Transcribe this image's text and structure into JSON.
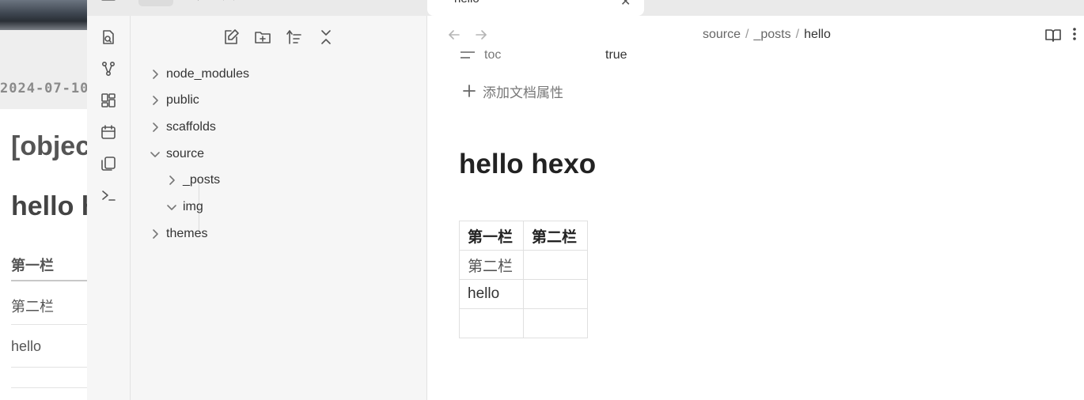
{
  "background_page": {
    "date": "2024-07-10",
    "object_heading": "[objec",
    "title": "hello h",
    "table_header": "第一栏",
    "rows": [
      "第二栏",
      "hello"
    ]
  },
  "tabs": {
    "active_tab_label": "hello"
  },
  "ribbon": {
    "icons": [
      "open-quick-switcher-icon",
      "graph-view-icon",
      "canvas-icon",
      "daily-note-calendar-icon",
      "templates-copy-icon",
      "command-palette-terminal-icon"
    ]
  },
  "explorer": {
    "toolbar": [
      "new-note-icon",
      "new-folder-icon",
      "sort-order-icon",
      "collapse-all-icon"
    ],
    "tree": {
      "node_modules": "node_modules",
      "public": "public",
      "scaffolds": "scaffolds",
      "source": "source",
      "posts": "_posts",
      "img": "img",
      "themes": "themes"
    }
  },
  "editor": {
    "breadcrumb": {
      "part1": "source",
      "part2": "_posts",
      "part3": "hello",
      "separator": "/"
    },
    "property": {
      "key": "toc",
      "value": "true"
    },
    "add_property_label": "添加文档属性",
    "heading": "hello hexo",
    "table": {
      "headers": [
        "第一栏",
        "第二栏"
      ],
      "rows": [
        [
          "第二栏",
          ""
        ],
        [
          "hello",
          ""
        ],
        [
          "",
          ""
        ]
      ]
    }
  },
  "colors": {
    "accent_bg": "#f6f6f6",
    "editor_bg": "#ffffff",
    "text": "#222222"
  }
}
